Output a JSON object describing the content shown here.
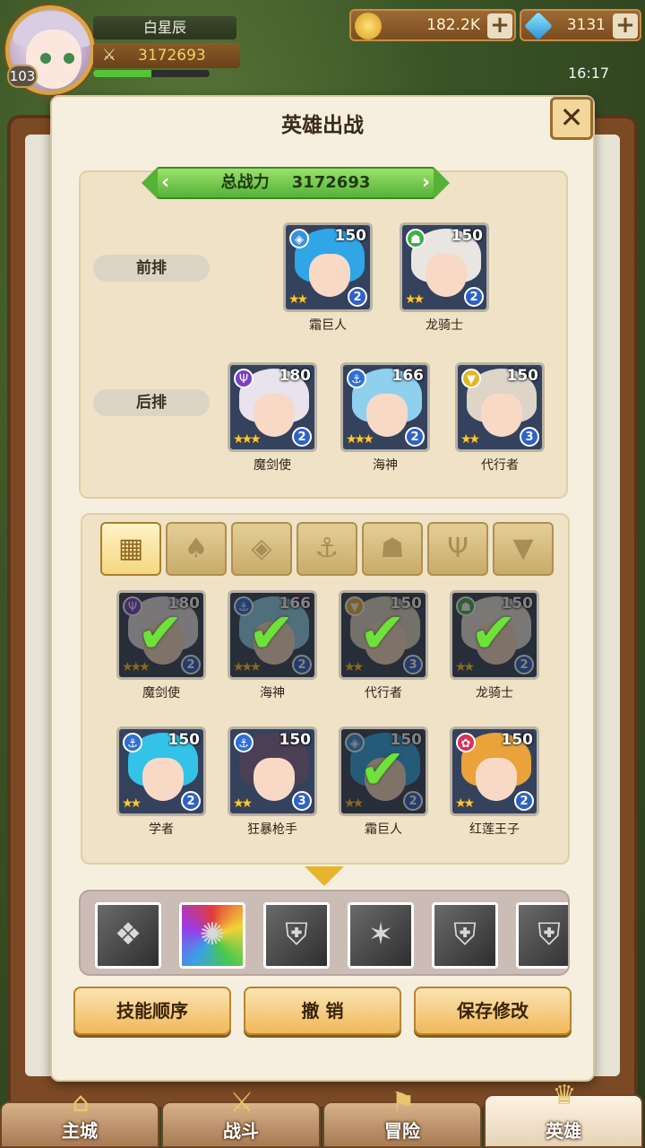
{
  "hud": {
    "player_name": "白星辰",
    "player_power": "3172693",
    "level": "103",
    "exp_fraction": 0.5,
    "gold": "182.2K",
    "diamonds": "3131",
    "time": "16:17"
  },
  "dialog": {
    "title": "英雄出战",
    "total_power_label": "总战力",
    "total_power_value": "3172693",
    "front_row_label": "前排",
    "back_row_label": "后排"
  },
  "front_row": [
    {
      "name": "霜巨人",
      "level": "150",
      "element": "frost-icon",
      "element_glyph": "◈",
      "element_color": "#3a8fe0",
      "stars": "★★",
      "count": "2",
      "hair": "#2fa6e6"
    },
    {
      "name": "龙骑士",
      "level": "150",
      "element": "dragon-icon",
      "element_glyph": "☗",
      "element_color": "#3fb04a",
      "stars": "★★",
      "count": "2",
      "hair": "#e9e6e2"
    }
  ],
  "back_row": [
    {
      "name": "魔剑使",
      "level": "180",
      "element": "demon-icon",
      "element_glyph": "Ψ",
      "element_color": "#7a3fc8",
      "stars": "★★★",
      "count": "2",
      "hair": "#e8e3ec"
    },
    {
      "name": "海神",
      "level": "166",
      "element": "anchor-icon",
      "element_glyph": "⚓",
      "element_color": "#2d6fd6",
      "stars": "★★★",
      "count": "2",
      "hair": "#8fd0ef"
    },
    {
      "name": "代行者",
      "level": "150",
      "element": "holy-icon",
      "element_glyph": "▼",
      "element_color": "#e3b52a",
      "stars": "★★",
      "count": "3",
      "hair": "#ded4c8"
    }
  ],
  "filter_tabs": [
    {
      "name": "all",
      "glyph": "▦"
    },
    {
      "name": "leaf",
      "glyph": "♠"
    },
    {
      "name": "frost",
      "glyph": "◈"
    },
    {
      "name": "anchor",
      "glyph": "⚓"
    },
    {
      "name": "dragon",
      "glyph": "☗"
    },
    {
      "name": "demon",
      "glyph": "Ψ"
    },
    {
      "name": "holy",
      "glyph": "▼"
    }
  ],
  "roster": [
    {
      "name": "魔剑使",
      "level": "180",
      "element_glyph": "Ψ",
      "element_color": "#7a3fc8",
      "stars": "★★★",
      "count": "2",
      "hair": "#e8e3ec",
      "selected": true
    },
    {
      "name": "海神",
      "level": "166",
      "element_glyph": "⚓",
      "element_color": "#2d6fd6",
      "stars": "★★★",
      "count": "2",
      "hair": "#8fd0ef",
      "selected": true
    },
    {
      "name": "代行者",
      "level": "150",
      "element_glyph": "▼",
      "element_color": "#e3b52a",
      "stars": "★★",
      "count": "3",
      "hair": "#ded4c8",
      "selected": true
    },
    {
      "name": "龙骑士",
      "level": "150",
      "element_glyph": "☗",
      "element_color": "#3fb04a",
      "stars": "★★",
      "count": "2",
      "hair": "#e9e6e2",
      "selected": true
    },
    {
      "name": "学者",
      "level": "150",
      "element_glyph": "⚓",
      "element_color": "#2d6fd6",
      "stars": "★★",
      "count": "2",
      "hair": "#33c3e8",
      "selected": false
    },
    {
      "name": "狂暴枪手",
      "level": "150",
      "element_glyph": "⚓",
      "element_color": "#2d6fd6",
      "stars": "★★",
      "count": "3",
      "hair": "#4b3f55",
      "selected": false
    },
    {
      "name": "霜巨人",
      "level": "150",
      "element_glyph": "◈",
      "element_color": "#3a8fe0",
      "stars": "★★",
      "count": "2",
      "hair": "#2fa6e6",
      "selected": true
    },
    {
      "name": "红莲王子",
      "level": "150",
      "element_glyph": "✿",
      "element_color": "#d8325a",
      "stars": "★★",
      "count": "2",
      "hair": "#e9a33a",
      "selected": false
    }
  ],
  "skills": [
    {
      "name": "wing-skill-icon",
      "glyph": "❖"
    },
    {
      "name": "rainbow-skill-icon",
      "glyph": "✺"
    },
    {
      "name": "shield-skill-icon",
      "glyph": "⛨"
    },
    {
      "name": "claw-skill-icon",
      "glyph": "✶"
    },
    {
      "name": "shield-skill-icon",
      "glyph": "⛨"
    },
    {
      "name": "shield-skill-icon",
      "glyph": "⛨"
    }
  ],
  "buttons": {
    "skill_order": "技能顺序",
    "undo": "撤 销",
    "save": "保存修改"
  },
  "nav": [
    {
      "label": "主城",
      "glyph": "⌂"
    },
    {
      "label": "战斗",
      "glyph": "⚔"
    },
    {
      "label": "冒险",
      "glyph": "⚑"
    },
    {
      "label": "英雄",
      "glyph": "♛"
    }
  ]
}
